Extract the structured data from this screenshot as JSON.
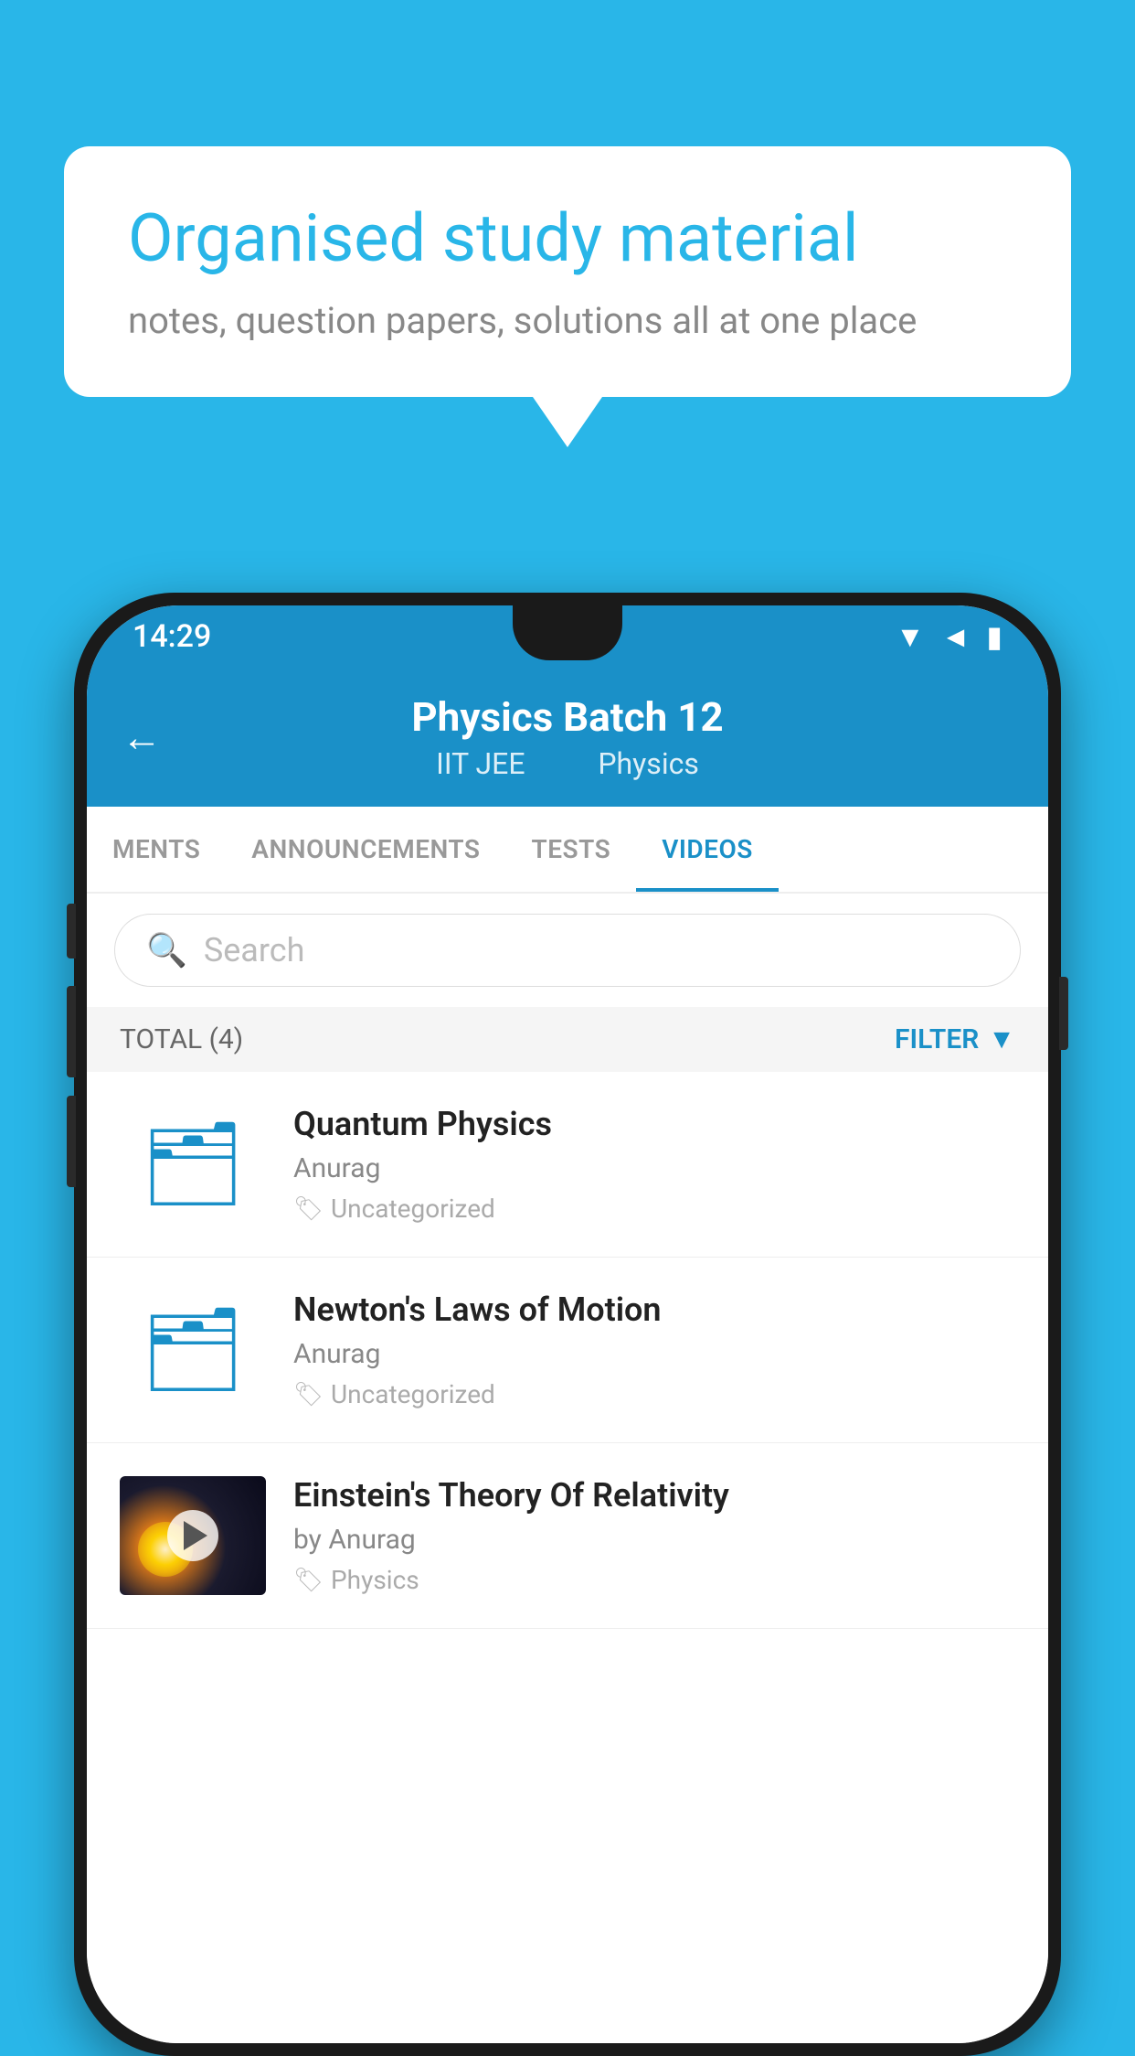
{
  "bubble": {
    "title": "Organised study material",
    "subtitle": "notes, question papers, solutions all at one place"
  },
  "status": {
    "time": "14:29"
  },
  "header": {
    "title": "Physics Batch 12",
    "subtitle1": "IIT JEE",
    "subtitle2": "Physics"
  },
  "tabs": [
    {
      "label": "MENTS",
      "active": false
    },
    {
      "label": "ANNOUNCEMENTS",
      "active": false
    },
    {
      "label": "TESTS",
      "active": false
    },
    {
      "label": "VIDEOS",
      "active": true
    }
  ],
  "search": {
    "placeholder": "Search"
  },
  "filter": {
    "total_label": "TOTAL (4)",
    "filter_label": "FILTER"
  },
  "videos": [
    {
      "title": "Quantum Physics",
      "author": "Anurag",
      "tag": "Uncategorized",
      "type": "folder"
    },
    {
      "title": "Newton's Laws of Motion",
      "author": "Anurag",
      "tag": "Uncategorized",
      "type": "folder"
    },
    {
      "title": "Einstein's Theory Of Relativity",
      "author": "by Anurag",
      "tag": "Physics",
      "type": "video"
    }
  ]
}
